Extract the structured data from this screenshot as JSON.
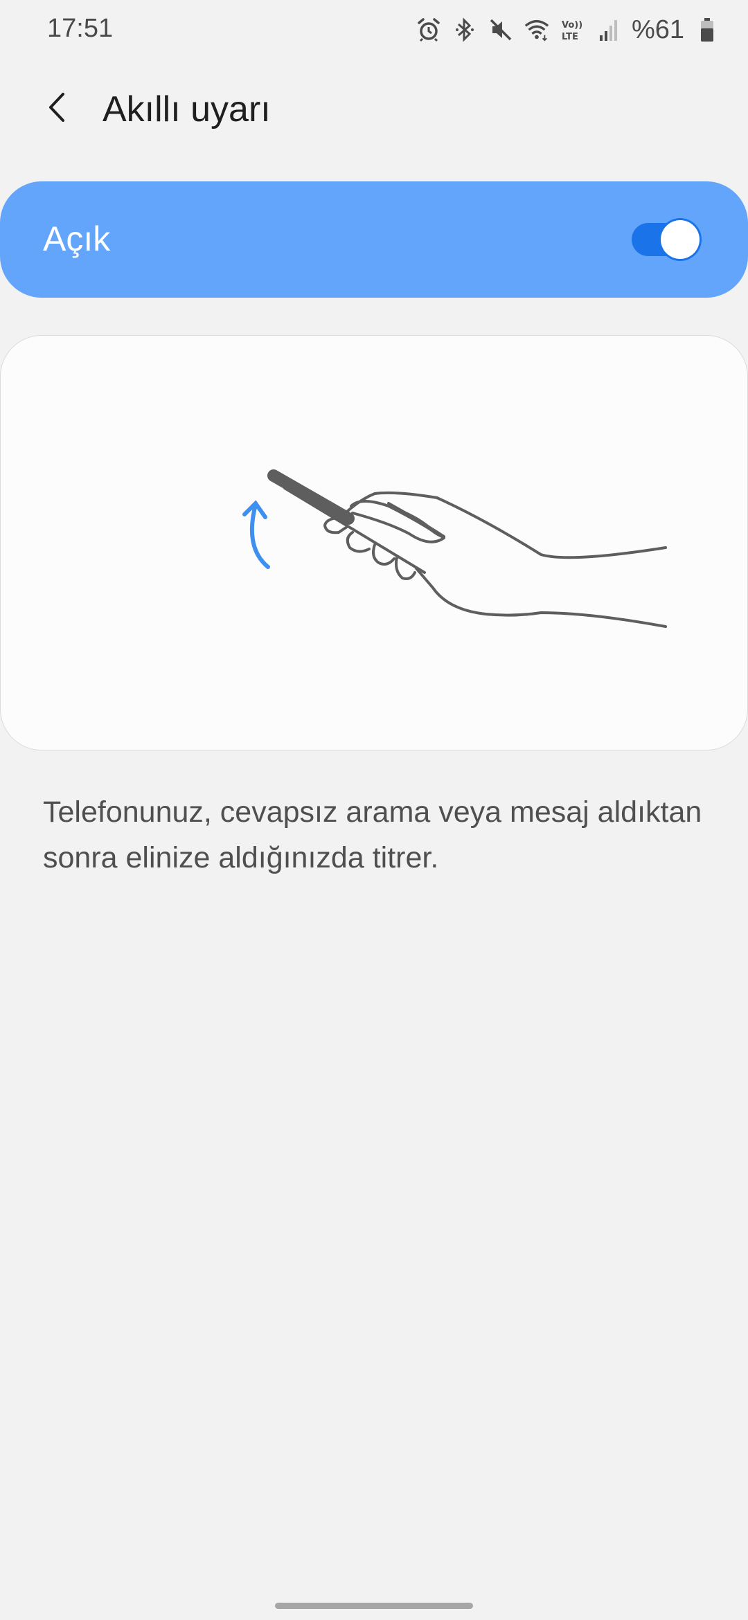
{
  "status_bar": {
    "time": "17:51",
    "battery_text": "%61",
    "icons": [
      "alarm-icon",
      "bluetooth-icon",
      "mute-icon",
      "wifi-icon",
      "volte-icon",
      "signal-icon",
      "battery-icon"
    ]
  },
  "header": {
    "title": "Akıllı uyarı",
    "back_icon": "back-arrow-icon"
  },
  "master_switch": {
    "label": "Açık",
    "enabled": true,
    "accent_color": "#62a5fa"
  },
  "illustration": {
    "icon": "hand-pickup-phone-illustration",
    "arrow_color": "#3d8ff0"
  },
  "description": "Telefonunuz, cevapsız arama veya mesaj aldıktan sonra elinize aldığınızda titrer."
}
